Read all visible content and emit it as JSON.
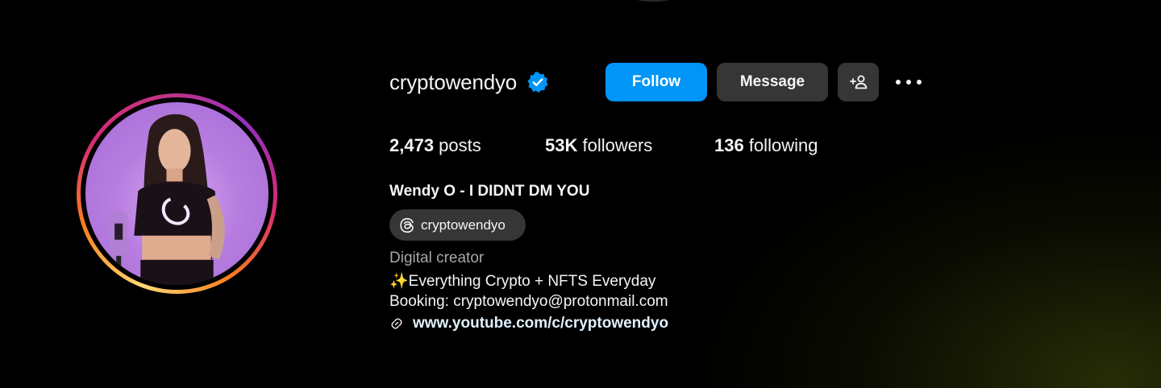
{
  "profile": {
    "username": "cryptowendyo",
    "verified": true,
    "actions": {
      "follow_label": "Follow",
      "message_label": "Message",
      "suggest_icon": "add-person-icon",
      "more_icon": "more-horizontal-icon"
    },
    "stats": {
      "posts_count": "2,473",
      "posts_label": " posts",
      "followers_count": "53K",
      "followers_label": " followers",
      "following_count": "136",
      "following_label": " following"
    },
    "full_name": "Wendy O - I DIDNT DM YOU",
    "threads_handle": "cryptowendyo",
    "category": "Digital creator",
    "bio_lines": [
      "✨Everything Crypto + NFTS Everyday",
      "Booking: cryptowendyo@protonmail.com"
    ],
    "link": "www.youtube.com/c/cryptowendyo"
  },
  "colors": {
    "primary_button": "#0095f6",
    "secondary_button": "#363636",
    "verified_badge": "#0095f6",
    "background": "#000000"
  }
}
